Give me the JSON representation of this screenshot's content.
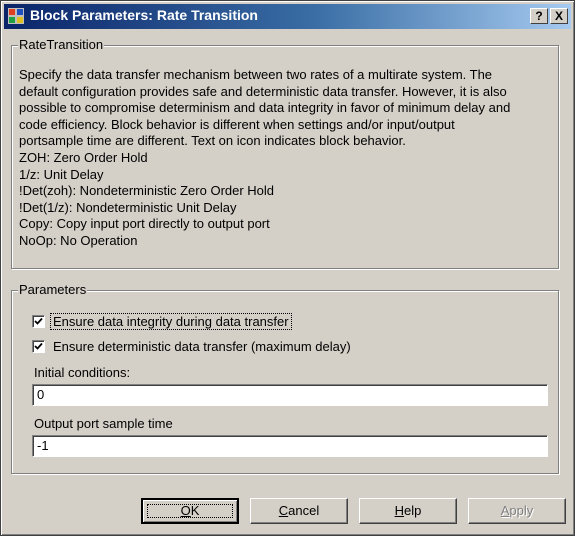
{
  "window": {
    "title": "Block Parameters: Rate Transition",
    "help_glyph": "?",
    "close_glyph": "X"
  },
  "rate_transition": {
    "label": "RateTransition",
    "description": [
      "Specify the data transfer mechanism between two rates of a multirate system. The",
      "default configuration provides safe and deterministic data transfer. However, it is also",
      "possible to compromise determinism and data integrity in favor of minimum delay and",
      "code efficiency. Block behavior is different when settings and/or input/output",
      "portsample time are different. Text on icon indicates block behavior.",
      "ZOH: Zero Order Hold",
      "1/z: Unit Delay",
      "!Det(zoh): Nondeterministic Zero Order Hold",
      "!Det(1/z): Nondeterministic Unit Delay",
      "Copy: Copy input port directly to output port",
      "NoOp: No Operation"
    ]
  },
  "parameters": {
    "label": "Parameters",
    "ensure_integrity": {
      "label": "Ensure data integrity during data transfer",
      "checked": true
    },
    "ensure_deterministic": {
      "label": "Ensure deterministic data transfer (maximum delay)",
      "checked": true
    },
    "initial_conditions": {
      "label": "Initial conditions:",
      "value": "0"
    },
    "output_sample_time": {
      "label": "Output port sample time",
      "value": "-1"
    }
  },
  "buttons": {
    "ok": {
      "first": "O",
      "rest": "K"
    },
    "cancel": {
      "first": "C",
      "rest": "ancel"
    },
    "help": {
      "first": "H",
      "rest": "elp"
    },
    "apply": {
      "first": "A",
      "rest": "pply",
      "enabled": false
    }
  },
  "colors": {
    "titlebar_start": "#0a246a",
    "titlebar_end": "#a6caf0",
    "face": "#d4d0c8"
  }
}
